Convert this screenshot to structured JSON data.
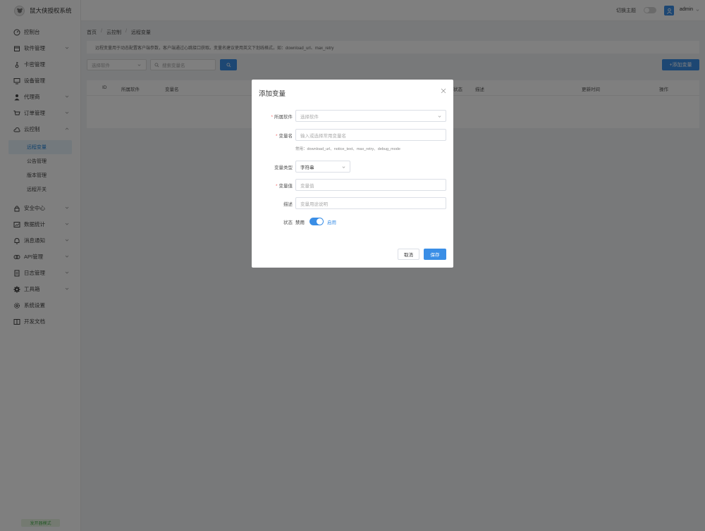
{
  "brand": {
    "name": "鼠大侠授权系统",
    "logo_icon": "mouse-logo-icon"
  },
  "header": {
    "theme_label": "切换主题",
    "user": "admin"
  },
  "sidebar": {
    "items": [
      {
        "label": "控制台",
        "icon": "dashboard-icon"
      },
      {
        "label": "软件管理",
        "icon": "package-icon",
        "has_children": true
      },
      {
        "label": "卡密管理",
        "icon": "key-icon"
      },
      {
        "label": "设备管理",
        "icon": "monitor-icon"
      },
      {
        "label": "代理商",
        "icon": "user-icon",
        "has_children": true
      },
      {
        "label": "订单管理",
        "icon": "cart-icon",
        "has_children": true
      },
      {
        "label": "云控制",
        "icon": "cloud-icon",
        "has_children": true,
        "expanded": true
      }
    ],
    "sub_items": [
      "远程变量",
      "公告管理",
      "版本管理",
      "远程开关"
    ],
    "items_after": [
      {
        "label": "安全中心",
        "icon": "lock-icon",
        "has_children": true
      },
      {
        "label": "数据统计",
        "icon": "chart-icon",
        "has_children": true
      },
      {
        "label": "消息通知",
        "icon": "bell-icon",
        "has_children": true
      },
      {
        "label": "API管理",
        "icon": "link-icon",
        "has_children": true
      },
      {
        "label": "日志管理",
        "icon": "file-icon",
        "has_children": true
      },
      {
        "label": "工具箱",
        "icon": "gear-icon",
        "has_children": true
      },
      {
        "label": "系统设置",
        "icon": "settings-icon"
      },
      {
        "label": "开发文档",
        "icon": "book-icon"
      }
    ],
    "footer": "发开器模式"
  },
  "breadcrumb": [
    "首页",
    "云控制",
    "远程变量"
  ],
  "notice": "远程变量用于动态配置客户端参数，客户端通过心跳接口获取。变量名建议使用英文下划线格式，如：download_url、max_retry",
  "filters": {
    "software_placeholder": "选择软件",
    "search_placeholder": "搜索变量名",
    "add_button": "+添加变量"
  },
  "table": {
    "columns": [
      "ID",
      "所属软件",
      "变量名",
      "状态",
      "描述",
      "更新时间",
      "操作"
    ]
  },
  "modal": {
    "title": "添加变量",
    "fields": {
      "software": {
        "label": "所属软件",
        "placeholder": "选择软件",
        "required": true
      },
      "name": {
        "label": "变量名",
        "placeholder": "输入或选择常用变量名",
        "required": true
      },
      "hint": "常用：download_url、notice_text、max_retry、debug_mode",
      "type": {
        "label": "变量类型",
        "value": "字符串"
      },
      "value": {
        "label": "变量值",
        "placeholder": "变量值",
        "required": true
      },
      "desc": {
        "label": "描述",
        "placeholder": "变量用途说明"
      },
      "status": {
        "label": "状态",
        "off": "禁用",
        "on": "启用",
        "enabled": true
      }
    },
    "cancel": "取消",
    "save": "保存"
  },
  "colors": {
    "primary": "#3a8ee6",
    "required": "#f56c6c",
    "overlay": "rgba(0,0,0,0.5)"
  }
}
